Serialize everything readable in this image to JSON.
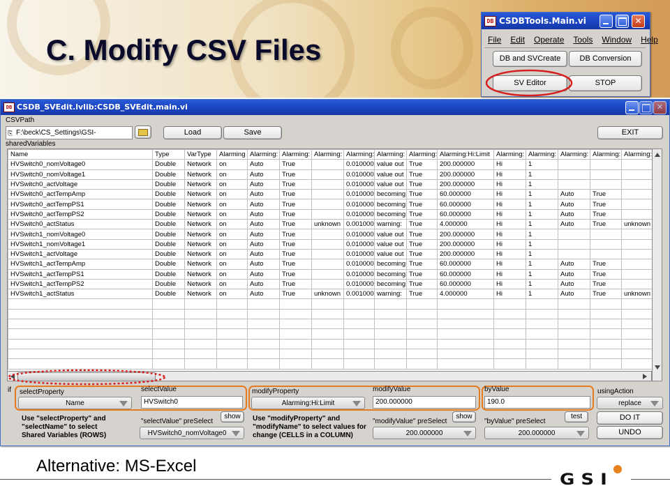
{
  "slide": {
    "title": "C. Modify CSV Files",
    "footer": "Alternative: MS-Excel",
    "logo_text": "GSI"
  },
  "colors": {
    "titlebar": "#1c47c4",
    "highlight_orange": "#e67a1e",
    "highlight_red": "#d61f1f",
    "window_bg": "#d6d3ce"
  },
  "csdbtools": {
    "title": "CSDBTools.Main.vi",
    "icon_text": "DB",
    "menu": [
      "File",
      "Edit",
      "Operate",
      "Tools",
      "Window",
      "Help"
    ],
    "buttons": {
      "db_svcreate": "DB and SVCreate",
      "db_conversion": "DB Conversion",
      "sv_editor": "SV Editor",
      "stop": "STOP"
    }
  },
  "editor": {
    "title": "CSDB_SVEdit.lvlib:CSDB_SVEdit.main.vi",
    "icon_text": "DB",
    "csvpath_label": "CSVPath",
    "csvpath_value": "F:\\beck\\CS_Settings\\GSI-",
    "load_label": "Load",
    "save_label": "Save",
    "exit_label": "EXIT",
    "shared_variables_label": "sharedVariables",
    "columns": [
      "Name",
      "Type",
      "VarType",
      "Alarming",
      "Alarming:",
      "Alarming:",
      "Alarming:",
      "Alarming:",
      "Alarming:",
      "Alarming:",
      "Alarming:Hi:Limit",
      "Alarming:",
      "Alarming:",
      "Alarming:",
      "Alarming:",
      "Alarming:"
    ],
    "rows": [
      [
        "HVSwitch0_nomVoltage0",
        "Double",
        "Network",
        "on",
        "Auto",
        "True",
        "",
        "0.010000",
        "value out",
        "True",
        "200.000000",
        "Hi",
        "1",
        "",
        "",
        ""
      ],
      [
        "HVSwitch0_nomVoltage1",
        "Double",
        "Network",
        "on",
        "Auto",
        "True",
        "",
        "0.010000",
        "value out",
        "True",
        "200.000000",
        "Hi",
        "1",
        "",
        "",
        ""
      ],
      [
        "HVSwitch0_actVoltage",
        "Double",
        "Network",
        "on",
        "Auto",
        "True",
        "",
        "0.010000",
        "value out",
        "True",
        "200.000000",
        "Hi",
        "1",
        "",
        "",
        ""
      ],
      [
        "HVSwitch0_actTempAmp",
        "Double",
        "Network",
        "on",
        "Auto",
        "True",
        "",
        "0.010000",
        "becoming",
        "True",
        "60.000000",
        "Hi",
        "1",
        "Auto",
        "True",
        ""
      ],
      [
        "HVSwitch0_actTempPS1",
        "Double",
        "Network",
        "on",
        "Auto",
        "True",
        "",
        "0.010000",
        "becoming",
        "True",
        "60.000000",
        "Hi",
        "1",
        "Auto",
        "True",
        ""
      ],
      [
        "HVSwitch0_actTempPS2",
        "Double",
        "Network",
        "on",
        "Auto",
        "True",
        "",
        "0.010000",
        "becoming",
        "True",
        "60.000000",
        "Hi",
        "1",
        "Auto",
        "True",
        ""
      ],
      [
        "HVSwitch0_actStatus",
        "Double",
        "Network",
        "on",
        "Auto",
        "True",
        "unknown",
        "0.001000",
        "warning:",
        "True",
        "4.000000",
        "Hi",
        "1",
        "Auto",
        "True",
        "unknown"
      ],
      [
        "HVSwitch1_nomVoltage0",
        "Double",
        "Network",
        "on",
        "Auto",
        "True",
        "",
        "0.010000",
        "value out",
        "True",
        "200.000000",
        "Hi",
        "1",
        "",
        "",
        ""
      ],
      [
        "HVSwitch1_nomVoltage1",
        "Double",
        "Network",
        "on",
        "Auto",
        "True",
        "",
        "0.010000",
        "value out",
        "True",
        "200.000000",
        "Hi",
        "1",
        "",
        "",
        ""
      ],
      [
        "HVSwitch1_actVoltage",
        "Double",
        "Network",
        "on",
        "Auto",
        "True",
        "",
        "0.010000",
        "value out",
        "True",
        "200.000000",
        "Hi",
        "1",
        "",
        "",
        ""
      ],
      [
        "HVSwitch1_actTempAmp",
        "Double",
        "Network",
        "on",
        "Auto",
        "True",
        "",
        "0.010000",
        "becoming",
        "True",
        "60.000000",
        "Hi",
        "1",
        "Auto",
        "True",
        ""
      ],
      [
        "HVSwitch1_actTempPS1",
        "Double",
        "Network",
        "on",
        "Auto",
        "True",
        "",
        "0.010000",
        "becoming",
        "True",
        "60.000000",
        "Hi",
        "1",
        "Auto",
        "True",
        ""
      ],
      [
        "HVSwitch1_actTempPS2",
        "Double",
        "Network",
        "on",
        "Auto",
        "True",
        "",
        "0.010000",
        "becoming",
        "True",
        "60.000000",
        "Hi",
        "1",
        "Auto",
        "True",
        ""
      ],
      [
        "HVSwitch1_actStatus",
        "Double",
        "Network",
        "on",
        "Auto",
        "True",
        "unknown",
        "0.001000",
        "warning:",
        "True",
        "4.000000",
        "Hi",
        "1",
        "Auto",
        "True",
        "unknown"
      ]
    ],
    "empty_rows": 7,
    "if_label": "if",
    "select_property_label": "selectProperty",
    "select_property_value": "Name",
    "select_value_label": "selectValue",
    "select_value_value": "HVSwitch0",
    "modify_property_label": "modifyProperty",
    "modify_property_value": "Alarming:Hi:Limit",
    "modify_value_label": "modifyValue",
    "modify_value_value": "200.000000",
    "by_value_label": "byValue",
    "by_value_value": "190.0",
    "using_action_label": "usingAction",
    "using_action_value": "replace",
    "note_select": "Use \"selectProperty\" and \"selectName\" to select Shared Variables (ROWS)",
    "select_value_preselect_label": "\"selectValue\" preSelect",
    "select_value_preselect_value": "HVSwitch0_nomVoltage0",
    "show_label": "show",
    "note_modify": "Use \"modifyProperty\" and \"modifyName\" to select values for change (CELLS in a COLUMN)",
    "modify_value_preselect_label": "\"modifyValue\" preSelect",
    "modify_value_preselect_value": "200.000000",
    "test_label": "test",
    "by_value_preselect_label": "\"byValue\" preSelect",
    "by_value_preselect_value": "200.000000",
    "do_it_label": "DO IT",
    "undo_label": "UNDO"
  }
}
